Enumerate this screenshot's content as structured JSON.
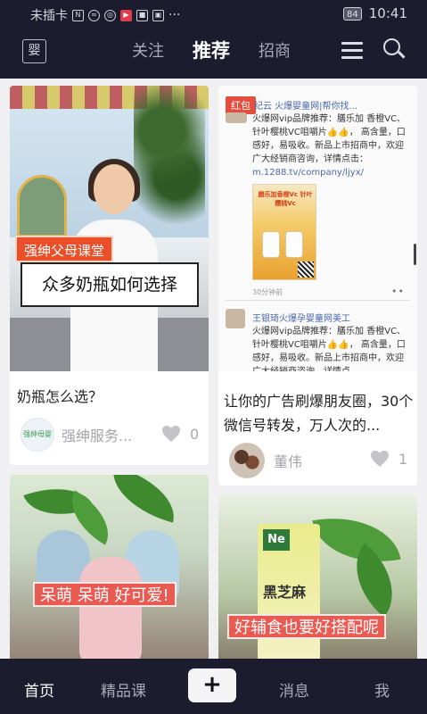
{
  "status_bar": {
    "carrier": "未插卡",
    "battery": "84",
    "time": "10:41"
  },
  "top_nav": {
    "logo": "婴",
    "tabs": [
      {
        "label": "关注",
        "active": false
      },
      {
        "label": "推荐",
        "active": true
      },
      {
        "label": "招商",
        "active": false
      }
    ],
    "icons": [
      "menu-icon",
      "search-icon"
    ]
  },
  "feed": {
    "cards": [
      {
        "image_tag": "强绅父母课堂",
        "image_caption": "众多奶瓶如何选择",
        "title": "奶瓶怎么选？",
        "author_avatar_text": "强绅母婴",
        "author": "强绅服务...",
        "likes": "0"
      },
      {
        "posts": [
          {
            "badge": "红包",
            "header": "纪云 火爆婴童网|帮你找...",
            "text": "火爆网vip品牌推荐：膳乐加 香橙VC、针叶樱桃VC咀嚼片👍👍， 高含量，口感好，易吸收。新品上市招商中，欢迎广大经销商咨询，详情点击：",
            "link": "m.1288.tv/company/ljyx/",
            "image_title": "膳乐加香橙Vc 针叶樱桃Vc",
            "meta": "30分钟前"
          },
          {
            "header": "王银琦火爆孕婴童网美工",
            "text": "火爆网vip品牌推荐：膳乐加 香橙VC、针叶樱桃VC咀嚼片👍👍， 高含量，口感好，易吸收。新品上市招商中，欢迎广大经销商咨询，详情点"
          }
        ],
        "title": "让你的广告刷爆朋友圈，30个微信号转发，万人次的...",
        "author": "董伟",
        "likes": "1"
      },
      {
        "image_tag": "呆萌 呆萌 好可爱!"
      },
      {
        "image_logo": "Ne",
        "image_box_text": "黑芝麻",
        "image_tag": "好辅食也要好搭配呢"
      }
    ]
  },
  "bottom_nav": {
    "items": [
      {
        "label": "首页",
        "active": true
      },
      {
        "label": "精品课",
        "active": false
      },
      {
        "label": "+",
        "active": false
      },
      {
        "label": "消息",
        "active": false
      },
      {
        "label": "我",
        "active": false
      }
    ]
  },
  "colors": {
    "nav_bg": "#1b1c2e",
    "feed_bg": "#f0f0f2",
    "tag_red": "#e85a52"
  }
}
